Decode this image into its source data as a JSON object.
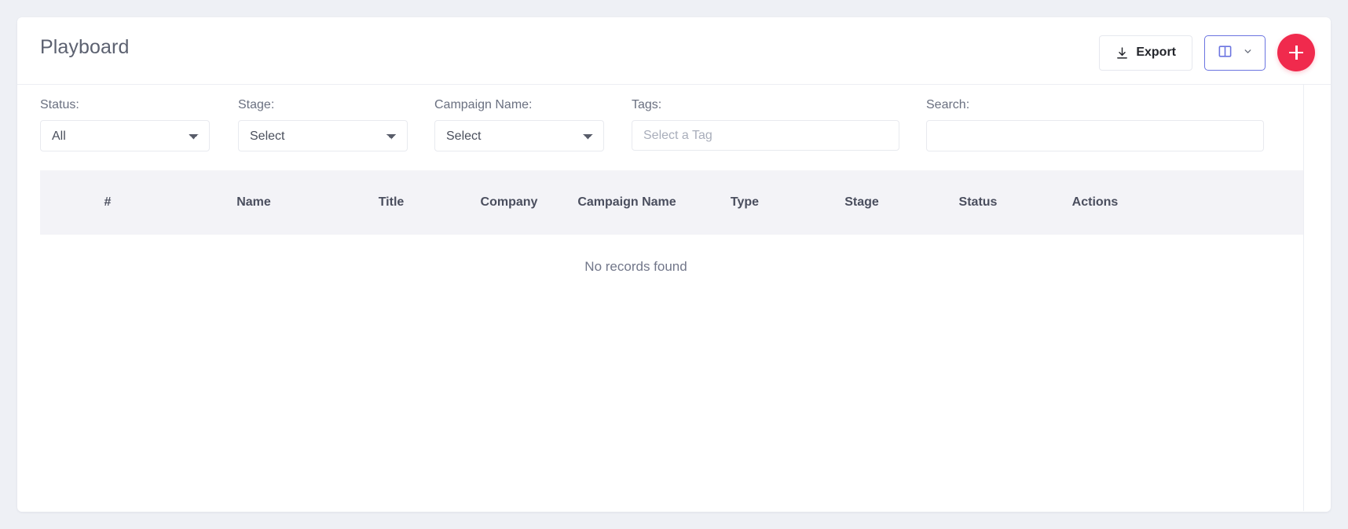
{
  "header": {
    "title": "Playboard",
    "export_label": "Export",
    "export_icon": "download-icon",
    "columns_icon": "columns-icon",
    "columns_chevron_icon": "chevron-down-icon",
    "add_icon": "plus-icon",
    "accent_color": "#f02a4d",
    "columns_border_color": "#6b74e0"
  },
  "filters": [
    {
      "label": "Status:",
      "type": "select",
      "value": "All",
      "name": "status"
    },
    {
      "label": "Stage:",
      "type": "select",
      "value": "Select",
      "name": "stage"
    },
    {
      "label": "Campaign Name:",
      "type": "select",
      "value": "Select",
      "name": "campaign-name"
    },
    {
      "label": "Tags:",
      "type": "input",
      "value": "",
      "placeholder": "Select a Tag",
      "name": "tags"
    },
    {
      "label": "Search:",
      "type": "input",
      "value": "",
      "placeholder": "",
      "name": "search"
    }
  ],
  "table": {
    "columns": [
      "#",
      "Name",
      "Title",
      "Company",
      "Campaign Name",
      "Type",
      "Stage",
      "Status",
      "Actions"
    ],
    "empty_message": "No records found",
    "rows": []
  }
}
